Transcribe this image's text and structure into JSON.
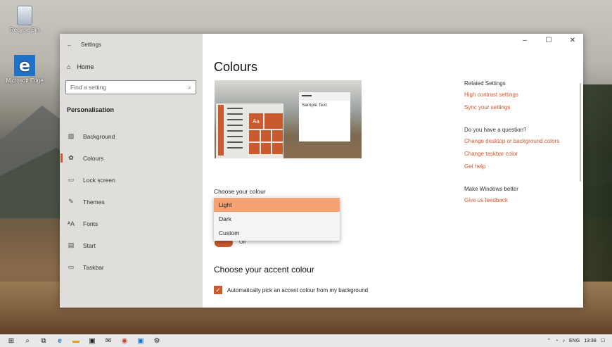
{
  "desktop": {
    "icons": [
      {
        "label": "Recycle Bin",
        "icon": "recycle-bin-icon"
      },
      {
        "label": "Microsoft Edge",
        "icon": "edge-icon"
      }
    ]
  },
  "window": {
    "title": "Settings",
    "controls": {
      "minimize": "–",
      "maximize": "☐",
      "close": "✕"
    }
  },
  "sidebar": {
    "back_glyph": "←",
    "home_label": "Home",
    "search_placeholder": "Find a setting",
    "section": "Personalisation",
    "items": [
      {
        "label": "Background",
        "icon": "image-icon",
        "glyph": "▨",
        "active": false
      },
      {
        "label": "Colours",
        "icon": "palette-icon",
        "glyph": "✿",
        "active": true
      },
      {
        "label": "Lock screen",
        "icon": "lock-screen-icon",
        "glyph": "▭",
        "active": false
      },
      {
        "label": "Themes",
        "icon": "themes-icon",
        "glyph": "✎",
        "active": false
      },
      {
        "label": "Fonts",
        "icon": "fonts-icon",
        "glyph": "ᴬA",
        "active": false
      },
      {
        "label": "Start",
        "icon": "start-icon",
        "glyph": "▤",
        "active": false
      },
      {
        "label": "Taskbar",
        "icon": "taskbar-icon",
        "glyph": "▭",
        "active": false
      }
    ]
  },
  "main": {
    "title": "Colours",
    "preview": {
      "sample_text": "Sample Text",
      "tile_text": "Aa"
    },
    "choose_colour_label": "Choose your colour",
    "dropdown": {
      "options": [
        "Light",
        "Dark",
        "Custom"
      ],
      "selected": "Light"
    },
    "toggle_text": "Off",
    "accent_title": "Choose your accent colour",
    "auto_accent_label": "Automatically pick an accent colour from my background",
    "auto_accent_checked": true
  },
  "related": {
    "heading": "Related Settings",
    "links": [
      "High contrast settings",
      "Sync your settings"
    ],
    "question_heading": "Do you have a question?",
    "question_links": [
      "Change desktop or background colors",
      "Change taskbar color",
      "Get help"
    ],
    "better_heading": "Make Windows better",
    "feedback_link": "Give us feedback"
  },
  "taskbar": {
    "language": "ENG",
    "time": "13:38"
  },
  "colors": {
    "accent": "#c95a2e",
    "link": "#d0582e",
    "selected_option": "#f5a373"
  }
}
